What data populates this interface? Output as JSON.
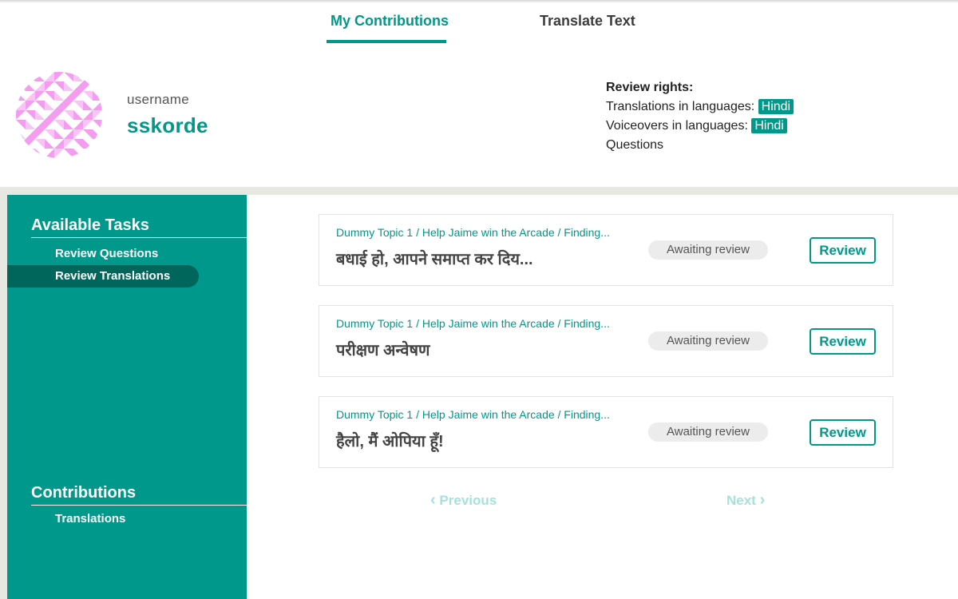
{
  "tabs": {
    "my_contributions": "My Contributions",
    "translate_text": "Translate Text"
  },
  "profile": {
    "username_label": "username",
    "username": "sskorde"
  },
  "review_rights": {
    "title": "Review rights:",
    "translations_label": "Translations in languages:",
    "translations_lang": "Hindi",
    "voiceovers_label": "Voiceovers in languages:",
    "voiceovers_lang": "Hindi",
    "questions": "Questions"
  },
  "sidebar": {
    "available_tasks": "Available Tasks",
    "review_questions": "Review Questions",
    "review_translations": "Review Translations",
    "contributions": "Contributions",
    "translations": "Translations"
  },
  "cards": [
    {
      "crumb": "Dummy Topic 1 / Help Jaime win the Arcade / Finding...",
      "text": "बधाई हो, आपने समाप्त कर दिय...",
      "status": "Awaiting review",
      "button": "Review"
    },
    {
      "crumb": "Dummy Topic 1 / Help Jaime win the Arcade / Finding...",
      "text": "परीक्षण अन्वेषण",
      "status": "Awaiting review",
      "button": "Review"
    },
    {
      "crumb": "Dummy Topic 1 / Help Jaime win the Arcade / Finding...",
      "text": "हैलो, मैं ओपिया हूँ!",
      "status": "Awaiting review",
      "button": "Review"
    }
  ],
  "pagination": {
    "previous": "Previous",
    "next": "Next"
  },
  "colors": {
    "accent": "#00988a",
    "accent_dark": "#00665c",
    "avatar_pink": "#f49cf0"
  }
}
